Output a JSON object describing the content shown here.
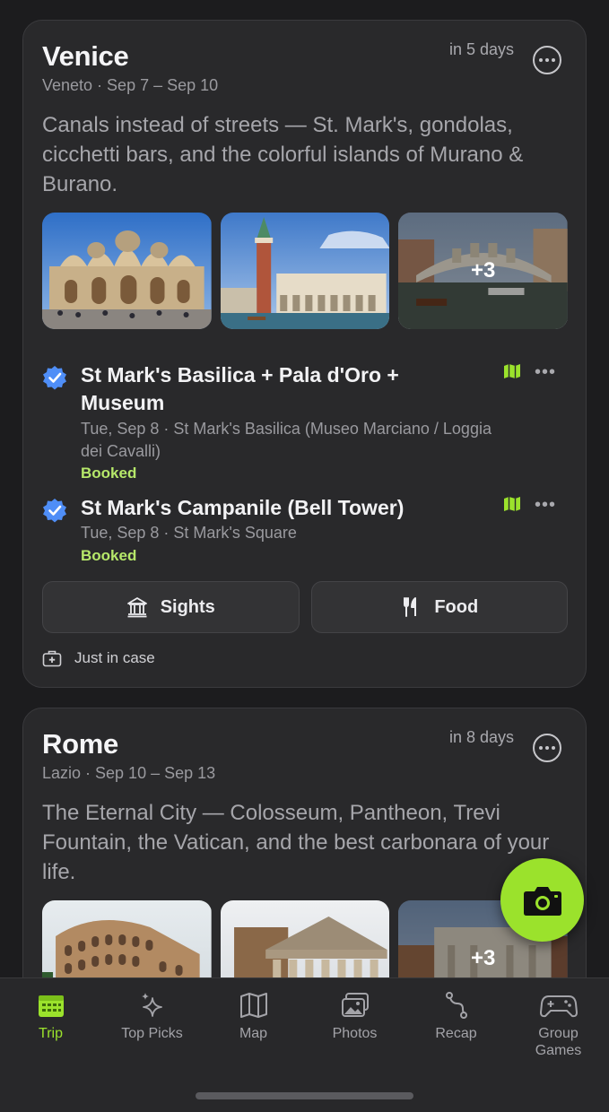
{
  "trips": [
    {
      "city": "Venice",
      "region_dates": "Veneto · Sep 7 – Sep 10",
      "eta": "in 5 days",
      "description": "Canals instead of streets — St. Mark's, gondolas, cicchetti bars, and the colorful islands of Murano & Burano.",
      "photos_more": "+3",
      "bookings": [
        {
          "title": "St Mark's Basilica + Pala d'Oro + Museum",
          "detail": "Tue, Sep 8 · St Mark's Basilica (Museo Marciano / Loggia dei Cavalli)",
          "status": "Booked"
        },
        {
          "title": "St Mark's Campanile (Bell Tower)",
          "detail": "Tue, Sep 8 · St Mark's Square",
          "status": "Booked"
        }
      ],
      "buttons": {
        "sights": "Sights",
        "food": "Food"
      },
      "just_in_case": "Just in case"
    },
    {
      "city": "Rome",
      "region_dates": "Lazio · Sep 10 – Sep 13",
      "eta": "in 8 days",
      "description": "The Eternal City — Colosseum, Pantheon, Trevi Fountain, the Vatican, and the best carbonara of your life.",
      "photos_more": "+3"
    }
  ],
  "tabs": [
    {
      "label": "Trip",
      "icon": "calendar-icon",
      "active": true
    },
    {
      "label": "Top Picks",
      "icon": "sparkles-icon"
    },
    {
      "label": "Map",
      "icon": "map-icon"
    },
    {
      "label": "Photos",
      "icon": "photos-icon"
    },
    {
      "label": "Recap",
      "icon": "route-icon"
    },
    {
      "label": "Group Games",
      "icon": "gamepad-icon"
    }
  ],
  "colors": {
    "accent": "#9be22c",
    "booked": "#b6e86a",
    "verified": "#4f8ef7",
    "background": "#1c1c1e",
    "card": "#29292b"
  }
}
